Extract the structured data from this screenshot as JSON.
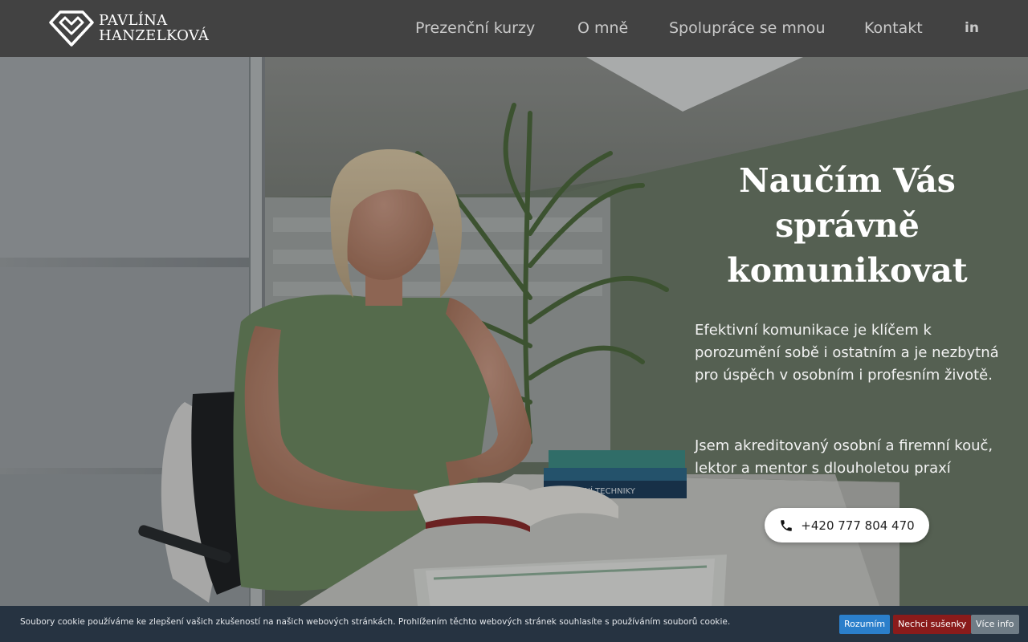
{
  "brand": {
    "line1": "PAVLÍNA",
    "line2": "HANZELKOVÁ",
    "logo_icon": "diamond-heart-logo"
  },
  "nav": {
    "items": [
      {
        "label": "Prezenční kurzy"
      },
      {
        "label": "O mně"
      },
      {
        "label": "Spolupráce se mnou"
      },
      {
        "label": "Kontakt"
      }
    ],
    "linkedin_label": "in"
  },
  "hero": {
    "title_line1": "Naučím Vás",
    "title_line2": "správně",
    "title_line3": "komunikovat",
    "paragraph1": "Efektivní komunikace je klíčem k porozumění sobě i ostatním a je nezbytná pro úspěch v osobním i profesním životě.",
    "paragraph2": "Jsem akreditovaný osobní a firemní kouč, lektor a mentor s dlouholetou praxí",
    "phone": "+420 777 804 470",
    "phone_icon": "phone-icon",
    "book_spine_text": "ODNÍ TECHNIKY"
  },
  "cookie": {
    "text": "Soubory cookie používáme ke zlepšení vašich zkušeností na našich webových stránkách. Prohlížením těchto webových stránek souhlasíte s používáním souborů cookie.",
    "accept": "Rozumím",
    "decline": "Nechci sušenky",
    "more": "Více info"
  },
  "colors": {
    "header_bg": "#424242",
    "cookie_bg": "#263341",
    "accept_btn": "#2b7fcb",
    "decline_btn": "#8a1b1b",
    "more_btn": "#6f7c86",
    "wall_green": "#76856f"
  }
}
